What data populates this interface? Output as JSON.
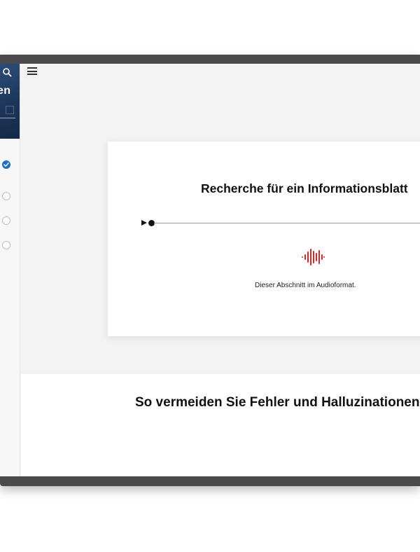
{
  "sidebar": {
    "hero_text": "en",
    "items": [
      {
        "status": "completed"
      },
      {
        "status": "not-started"
      },
      {
        "status": "not-started"
      },
      {
        "status": "not-started"
      }
    ]
  },
  "audio_block": {
    "title": "Recherche für ein Informationsblatt",
    "caption": "Dieser Abschnitt im Audioformat."
  },
  "next_section": {
    "heading": "So vermeiden Sie Fehler und Halluzinationen"
  },
  "colors": {
    "accent": "#1f70c1",
    "audio_icon": "#d62828",
    "hero_bg": "#1c3559",
    "device_frame": "#4a4a4c"
  }
}
